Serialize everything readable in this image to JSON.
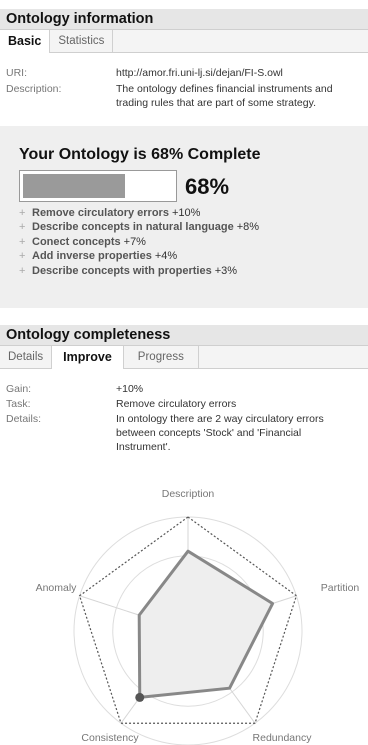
{
  "info_panel": {
    "title": "Ontology information",
    "tabs": [
      {
        "label": "Basic"
      },
      {
        "label": "Statistics"
      }
    ],
    "uri_label": "URI:",
    "uri_value": "http://amor.fri.uni-lj.si/dejan/FI-S.owl",
    "desc_label": "Description:",
    "desc_line1": "The ontology defines financial instruments and",
    "desc_line2": "trading rules that are part of some strategy."
  },
  "completeness_box": {
    "title": "Your Ontology is 68% Complete",
    "progress": 0.68,
    "percent": "68%",
    "tips": [
      {
        "text": "Remove circulatory errors",
        "gain": "+10%"
      },
      {
        "text": "Describe concepts in natural language",
        "gain": "+8%"
      },
      {
        "text": "Conect concepts",
        "gain": "+7%"
      },
      {
        "text": "Add inverse properties",
        "gain": "+4%"
      },
      {
        "text": "Describe concepts with properties",
        "gain": "+3%"
      }
    ]
  },
  "completeness_panel": {
    "title": "Ontology completeness",
    "tabs": [
      {
        "label": "Details"
      },
      {
        "label": "Improve"
      },
      {
        "label": "Progress"
      }
    ],
    "gain_label": "Gain:",
    "gain_value": "+10%",
    "task_label": "Task:",
    "task_value": "Remove circulatory errors",
    "details_label": "Details:",
    "details_line1": "In ontology there are 2 way circulatory errors",
    "details_line2": "between concepts 'Stock' and 'Financial",
    "details_line3": "Instrument'."
  },
  "radar": {
    "axes": [
      "Description",
      "Partition",
      "Redundancy",
      "Consistency",
      "Anomaly"
    ],
    "values": [
      0.7,
      0.78,
      0.62,
      0.72,
      0.45
    ],
    "highlight_axis": "Consistency",
    "fill_color": "#eeeeee",
    "stroke_color": "#888888",
    "highlight_color": "#555555"
  }
}
